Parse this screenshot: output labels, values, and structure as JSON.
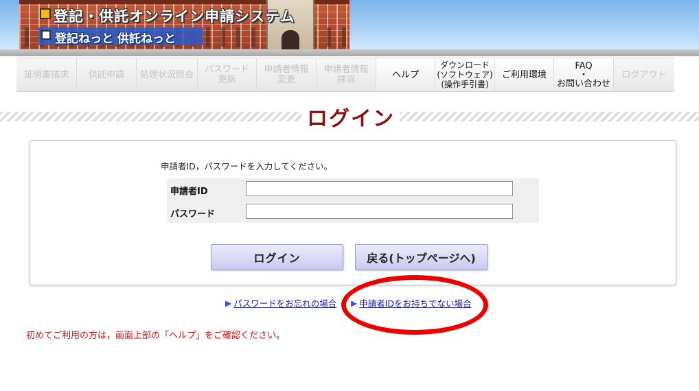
{
  "header": {
    "title": "登記・供託オンライン申請システム",
    "subtitle": "登記ねっと 供託ねっと"
  },
  "nav": [
    {
      "label": "証明書請求",
      "enabled": false
    },
    {
      "label": "供託申請",
      "enabled": false
    },
    {
      "label": "処理状況照会",
      "enabled": false
    },
    {
      "label": "パスワード\n更新",
      "enabled": false
    },
    {
      "label": "申請者情報\n変更",
      "enabled": false
    },
    {
      "label": "申請者情報\n抹消",
      "enabled": false
    },
    {
      "label": "ヘルプ",
      "enabled": true
    },
    {
      "label": "ダウンロード\n(ソフトウェア)\n(操作手引書)",
      "enabled": true
    },
    {
      "label": "ご利用環境",
      "enabled": true
    },
    {
      "label": "FAQ\n・\nお問い合わせ",
      "enabled": true
    },
    {
      "label": "ログアウト",
      "enabled": false
    }
  ],
  "page_title": "ログイン",
  "login_form": {
    "instruction": "申請者ID，パスワードを入力してください。",
    "id_label": "申請者ID",
    "id_value": "",
    "password_label": "パスワード",
    "password_value": "",
    "login_button": "ログイン",
    "back_button": "戻る(トップページへ)"
  },
  "links": {
    "forgot_password": "パスワードをお忘れの場合",
    "no_id": "申請者IDをお持ちでない場合"
  },
  "notice": "初めてご利用の方は，画面上部の「ヘルプ」をご確認ください。",
  "colors": {
    "title": "#8b1010",
    "notice": "#cc1111",
    "link": "#1a1aa8",
    "highlight_ring": "#ee0000",
    "button": "#c9c9f2"
  }
}
